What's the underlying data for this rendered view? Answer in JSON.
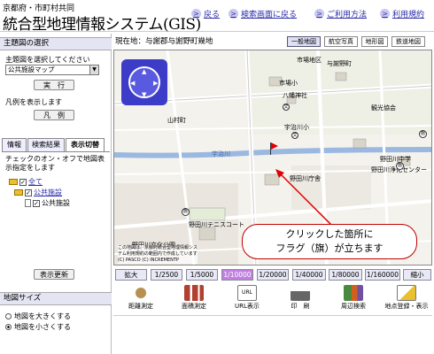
{
  "header": {
    "org": "京都府・市町村共同",
    "title": "統合型地理情報システム(GIS)",
    "nav": [
      "戻る",
      "検索画面に戻る",
      "ご利用方法",
      "利用規約"
    ]
  },
  "left": {
    "theme_title": "主題図の選択",
    "theme_prompt": "主題図を選択してください",
    "theme_select": "公共施設マップ",
    "run_label": "実　行",
    "legend_prompt": "凡例を表示します",
    "legend_label": "凡　例",
    "tabs": [
      "情報",
      "検索結果",
      "表示切替"
    ],
    "toggle_text": "チェックのオン・オフで地図表示指定をします",
    "tree": [
      "全て",
      "公共施設",
      "公共施設"
    ],
    "refresh_label": "表示更新",
    "size_title": "地図サイズ",
    "size_options": [
      "地図を大きくする",
      "地図を小さくする"
    ]
  },
  "map": {
    "location": "現在地：与謝郡与謝野町幾地",
    "types": [
      "一般地図",
      "航空写真",
      "地形図",
      "鉄道地図"
    ],
    "labels": [
      "市場小",
      "市場地区",
      "八幡神社",
      "宇治川小",
      "野田川中学",
      "野田川浄化センター",
      "野田川庁舎",
      "野田川テニスコート",
      "野田川文化公園",
      "与謝野町",
      "宇治川",
      "観光協会",
      "山村町"
    ],
    "copyright": [
      "この地図は、京都府統合型地理情報システム利用規約の範囲内で作成しています",
      "(C) PASCO (C) INCREMENTP"
    ],
    "callout": [
      "クリックした箇所に",
      "フラグ（旗）が立ちます"
    ]
  },
  "scale": {
    "zoom_in": "拡大",
    "values": [
      "1/2500",
      "1/5000",
      "1/10000",
      "1/20000",
      "1/40000",
      "1/80000",
      "1/160000"
    ],
    "zoom_out": "縮小",
    "active": "1/10000"
  },
  "toolbar": [
    "距離測定",
    "面積測定",
    "URL表示",
    "印　刷",
    "周辺検索",
    "地点登録・表示"
  ],
  "colors": {
    "accent": "#3c3cc8",
    "tab_bg": "#e4e4f2",
    "active_scale": "#c080e0",
    "callout_border": "#c00000",
    "flag": "#e00000"
  }
}
